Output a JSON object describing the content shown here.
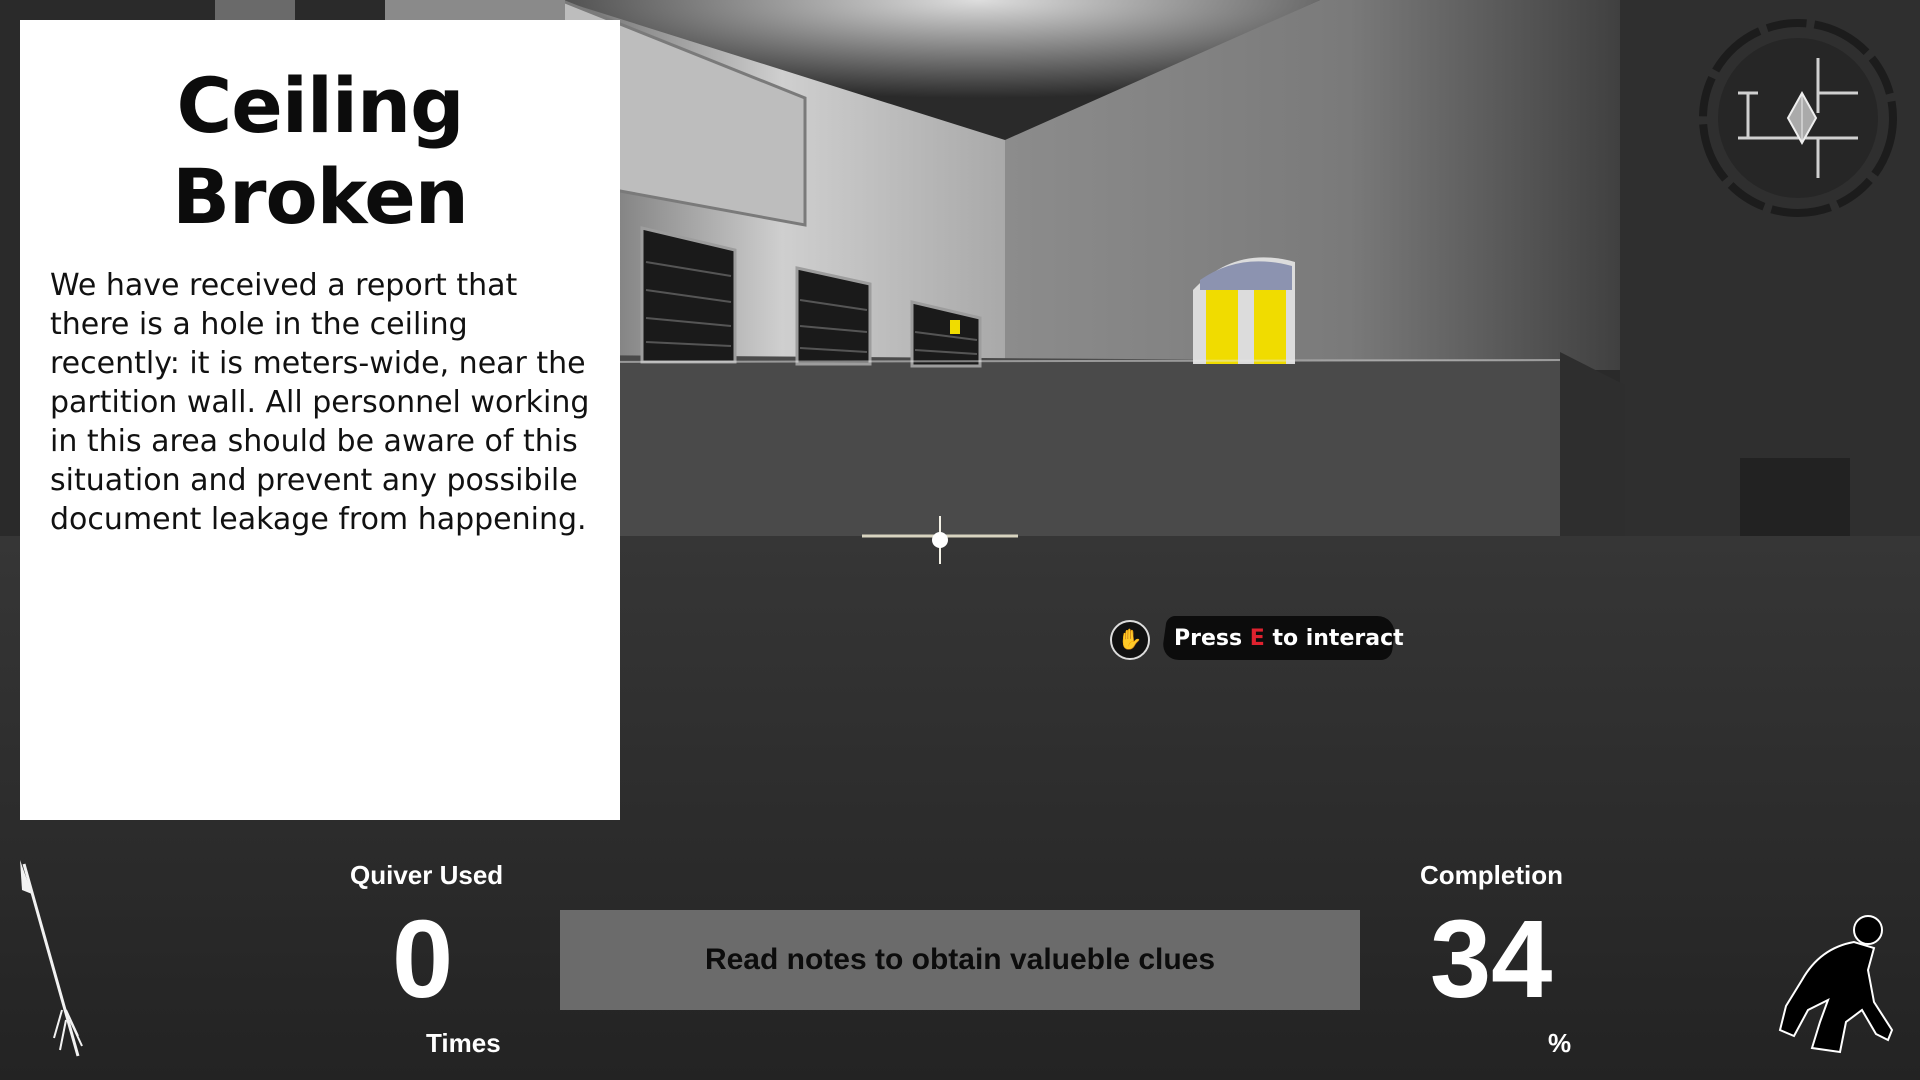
{
  "note": {
    "title": "Ceiling Broken",
    "body": "We have received a report that there is a hole in the ceiling recently: it is meters-wide, near the partition wall. All personnel working in this area should be aware of this situation and prevent any possibile document leakage from happening."
  },
  "prompt": {
    "prefix": "Press ",
    "key": "E",
    "suffix": " to interact",
    "icon": "hand-grab-icon"
  },
  "hud": {
    "quiver_label": "Quiver Used",
    "quiver_value": "0",
    "quiver_unit": "Times",
    "tip": "Read notes to obtain valueble clues",
    "completion_label": "Completion",
    "completion_value": "34",
    "completion_unit": "%"
  },
  "icons": {
    "weapon": "arrow-icon",
    "stance": "crouching-figure-icon",
    "minimap": "compass-minimap-icon",
    "reticle": "crosshair-icon"
  },
  "colors": {
    "accent_key": "#e0222f",
    "door_yellow": "#f0dc00",
    "tip_bar": "#6b6b6b"
  }
}
